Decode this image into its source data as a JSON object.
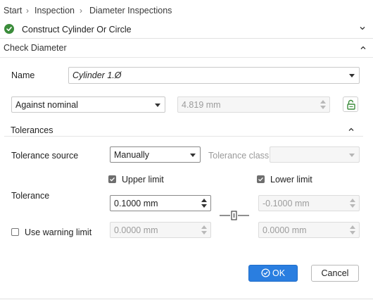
{
  "breadcrumb": {
    "items": [
      "Start",
      "Inspection",
      "Diameter Inspections"
    ],
    "separator": ">"
  },
  "step": {
    "label": "Construct Cylinder Or Circle",
    "status": "completed",
    "status_color": "#3b8c3b",
    "icon": "check-circle-icon"
  },
  "section": {
    "title": "Check Diameter",
    "collapse_icon": "chevron-up-icon"
  },
  "name_field": {
    "label": "Name",
    "value": "Cylinder 1.Ø"
  },
  "comparison": {
    "mode": "Against nominal",
    "nominal_value": "4.819 mm",
    "lock_icon": "unlock-icon"
  },
  "tolerances": {
    "title": "Tolerances",
    "source_label": "Tolerance source",
    "source_value": "Manually",
    "class_label": "Tolerance class",
    "class_value": "",
    "upper_limit_label": "Upper limit",
    "upper_limit_checked": true,
    "lower_limit_label": "Lower limit",
    "lower_limit_checked": true,
    "tolerance_label": "Tolerance",
    "upper_value": "0.1000 mm",
    "lower_value": "-0.1000 mm",
    "link_icon": "link-icon",
    "warning_label": "Use warning limit",
    "warning_checked": false,
    "warning_upper_value": "0.0000 mm",
    "warning_lower_value": "0.0000 mm"
  },
  "buttons": {
    "ok_label": "OK",
    "cancel_label": "Cancel"
  },
  "colors": {
    "accent": "#2a7ee0",
    "success": "#3b8c3b"
  }
}
